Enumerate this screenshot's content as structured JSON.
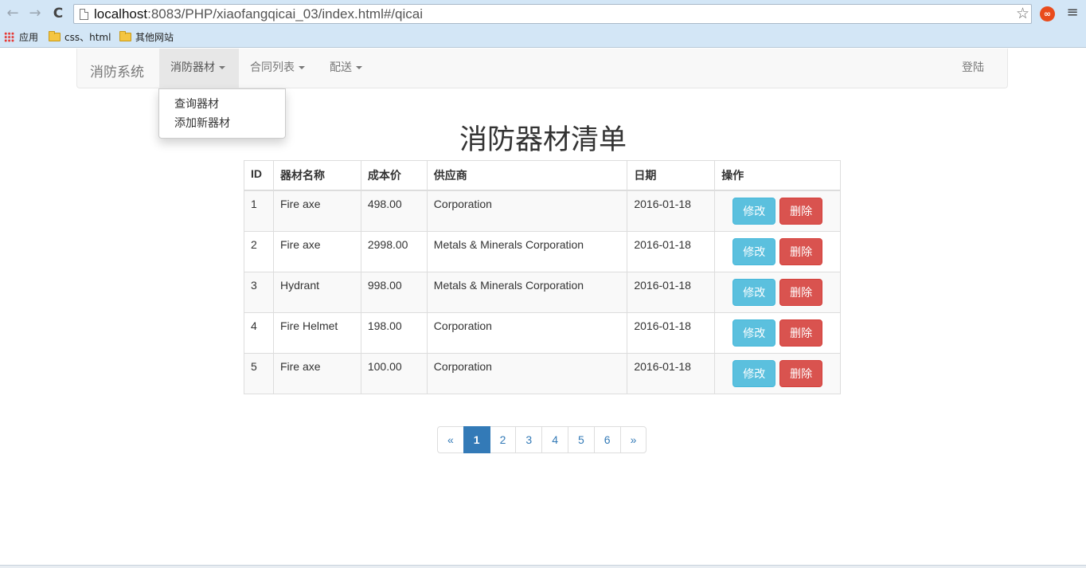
{
  "browser": {
    "url_host": "localhost",
    "url_rest": ":8083/PHP/xiaofangqicai_03/index.html#/qicai",
    "back_icon": "←",
    "forward_icon": "→",
    "reload_icon": "C",
    "star_icon": "☆",
    "extension_icon": "∞",
    "menu_icon": "≡",
    "bookmarks": {
      "apps": "应用",
      "folder1": "css、html",
      "folder2": "其他网站"
    }
  },
  "navbar": {
    "brand": "消防系统",
    "items": [
      {
        "label": "消防器材"
      },
      {
        "label": "合同列表"
      },
      {
        "label": "配送"
      }
    ],
    "login": "登陆",
    "dropdown": [
      "查询器材",
      "添加新器材"
    ]
  },
  "main": {
    "title": "消防器材清单",
    "table": {
      "headers": [
        "ID",
        "器材名称",
        "成本价",
        "供应商",
        "日期",
        "操作"
      ],
      "rows": [
        {
          "id": "1",
          "name": "Fire axe",
          "price": "498.00",
          "supplier": "Corporation",
          "date": "2016-01-18"
        },
        {
          "id": "2",
          "name": "Fire axe",
          "price": "2998.00",
          "supplier": "Metals & Minerals Corporation",
          "date": "2016-01-18"
        },
        {
          "id": "3",
          "name": "Hydrant",
          "price": "998.00",
          "supplier": "Metals & Minerals Corporation",
          "date": "2016-01-18"
        },
        {
          "id": "4",
          "name": "Fire Helmet",
          "price": "198.00",
          "supplier": "Corporation",
          "date": "2016-01-18"
        },
        {
          "id": "5",
          "name": "Fire axe",
          "price": "100.00",
          "supplier": "Corporation",
          "date": "2016-01-18"
        }
      ],
      "edit_label": "修改",
      "delete_label": "删除"
    },
    "pagination": {
      "prev": "«",
      "pages": [
        "1",
        "2",
        "3",
        "4",
        "5",
        "6"
      ],
      "next": "»",
      "current": "1"
    }
  },
  "colors": {
    "primary": "#337ab7",
    "info": "#5bc0de",
    "danger": "#d9534f",
    "chrome_bg": "#d3e6f6"
  }
}
